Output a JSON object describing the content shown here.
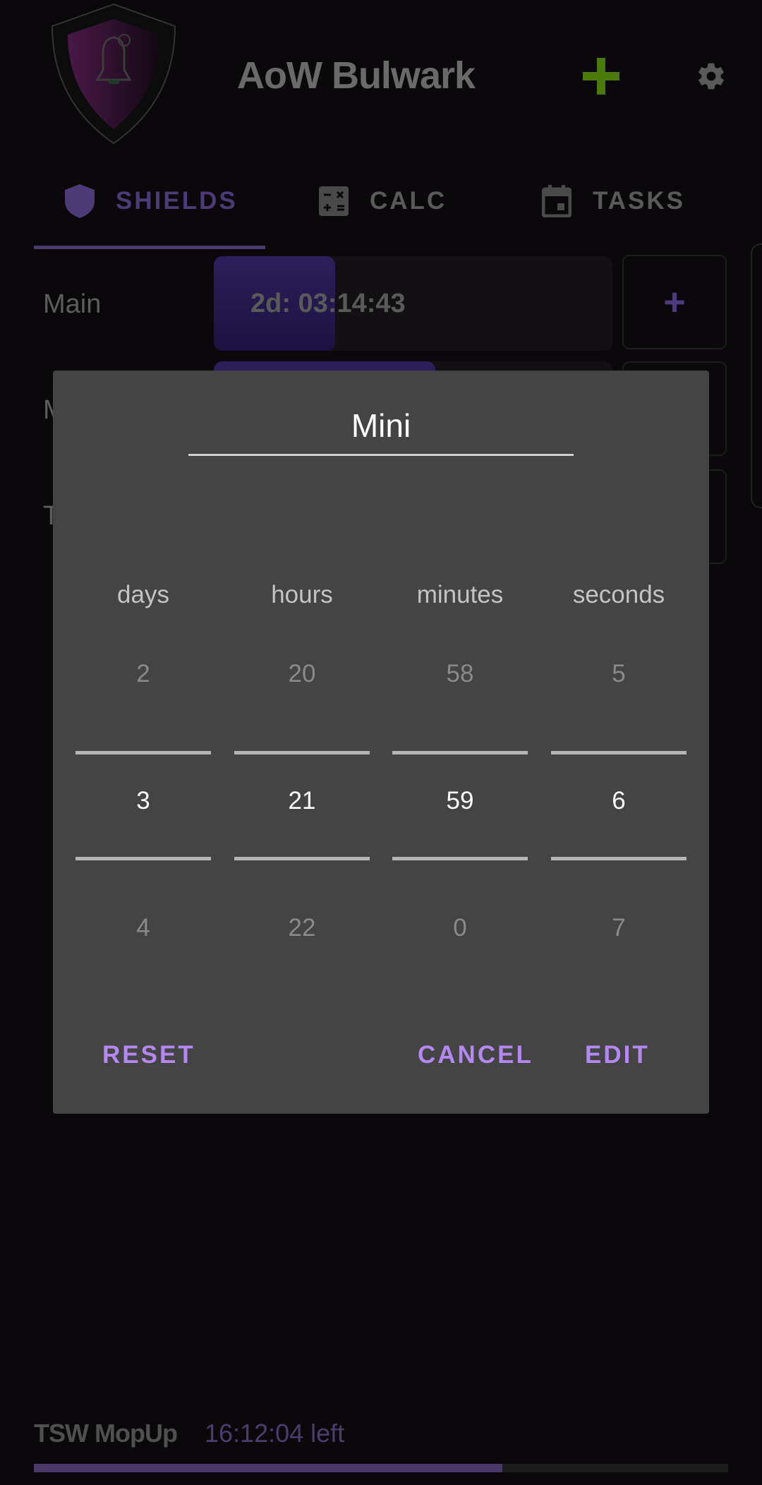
{
  "header": {
    "title": "AoW Bulwark",
    "add_icon": "plus-icon",
    "settings_icon": "gear-icon",
    "accent_add": "#4a7a0a"
  },
  "tabs": [
    {
      "label": "SHIELDS",
      "icon": "shield-icon",
      "active": true
    },
    {
      "label": "CALC",
      "icon": "calculator-icon",
      "active": false
    },
    {
      "label": "TASKS",
      "icon": "calendar-icon",
      "active": false
    }
  ],
  "shields": [
    {
      "label": "Main",
      "timer": "2d: 03:14:43",
      "add_label": "+"
    },
    {
      "label": "M",
      "add_label": "+"
    },
    {
      "label": "T",
      "add_label": "+"
    }
  ],
  "dialog": {
    "name_value": "Mini",
    "columns": [
      {
        "header": "days",
        "prev": "2",
        "selected": "3",
        "next": "4"
      },
      {
        "header": "hours",
        "prev": "20",
        "selected": "21",
        "next": "22"
      },
      {
        "header": "minutes",
        "prev": "58",
        "selected": "59",
        "next": "0"
      },
      {
        "header": "seconds",
        "prev": "5",
        "selected": "6",
        "next": "7"
      }
    ],
    "reset_label": "RESET",
    "cancel_label": "CANCEL",
    "edit_label": "EDIT",
    "accent": "#b388f0"
  },
  "footer": {
    "task_name": "TSW MopUp",
    "time_left": "16:12:04 left",
    "progress_percent": 67.5
  }
}
